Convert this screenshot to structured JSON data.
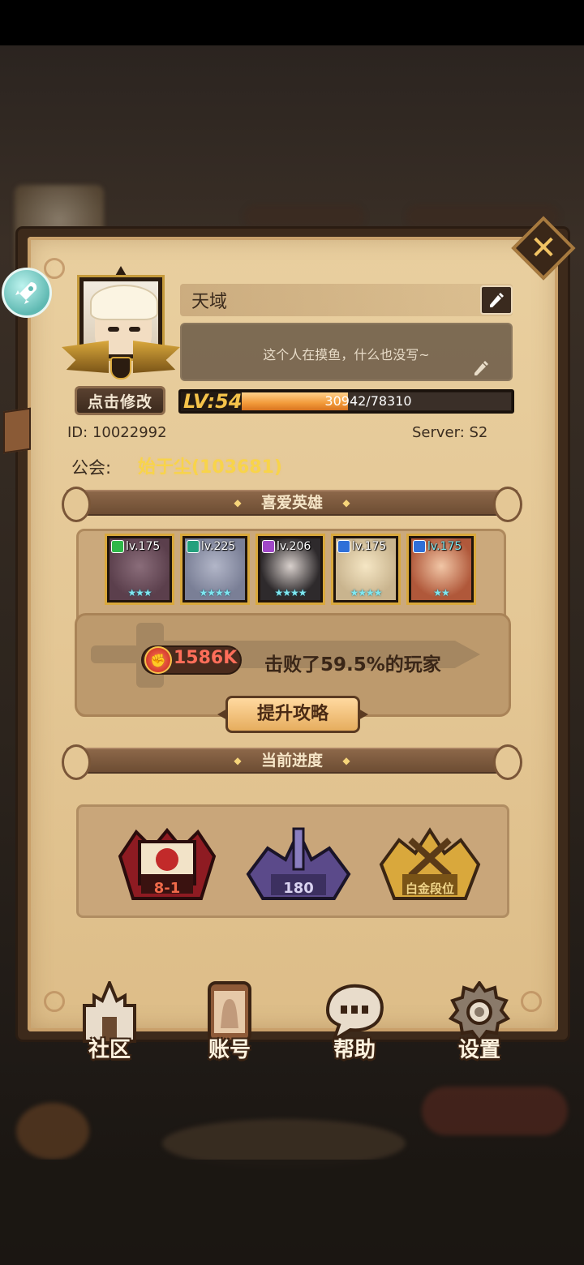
{
  "profile": {
    "name": "天域",
    "signature": "这个人在摸鱼，什么也没写~",
    "edit_avatar_label": "点击修改",
    "level_label": "LV:54",
    "exp_text": "30942/78310",
    "exp_fraction": 0.395,
    "id_text": "ID:  10022992",
    "server_text": "Server: S2",
    "guild_label": "公会:",
    "guild_value": "始于尘(103681)"
  },
  "favorite_section": {
    "title": "喜爱英雄",
    "heroes": [
      {
        "level": "lv.175",
        "element_color": "#2fb84a",
        "stars": "★★★",
        "art_color": "#5b3f4c"
      },
      {
        "level": "lv.225",
        "element_color": "#23a07c",
        "stars": "★★★★",
        "art_color": "#7a7f96"
      },
      {
        "level": "lv.206",
        "element_color": "#a048c8",
        "stars": "★★★★",
        "art_color": "#2e2a2c"
      },
      {
        "level": "lv.175",
        "element_color": "#2f6fd8",
        "stars": "★★★★",
        "art_color": "#c9b48e"
      },
      {
        "level": "lv.175",
        "element_color": "#2f6fd8",
        "stars": "★★",
        "art_color": "#b0583a"
      }
    ]
  },
  "power": {
    "value": "1586K",
    "beat_text": "击败了59.5%的玩家",
    "strategy_button": "提升攻略"
  },
  "progress_section": {
    "title": "当前进度",
    "items": [
      {
        "label": "8-1",
        "color": "#f06a4a"
      },
      {
        "label": "180",
        "color": "#d9d3f0"
      },
      {
        "label": "白金段位",
        "color": "#f1d68a"
      }
    ]
  },
  "nav": {
    "community": "社区",
    "account": "账号",
    "help": "帮助",
    "settings": "设置"
  },
  "colors": {
    "panel_bg": "#e4c795",
    "banner": "#7a5638",
    "accent_gold": "#d9a83c"
  }
}
